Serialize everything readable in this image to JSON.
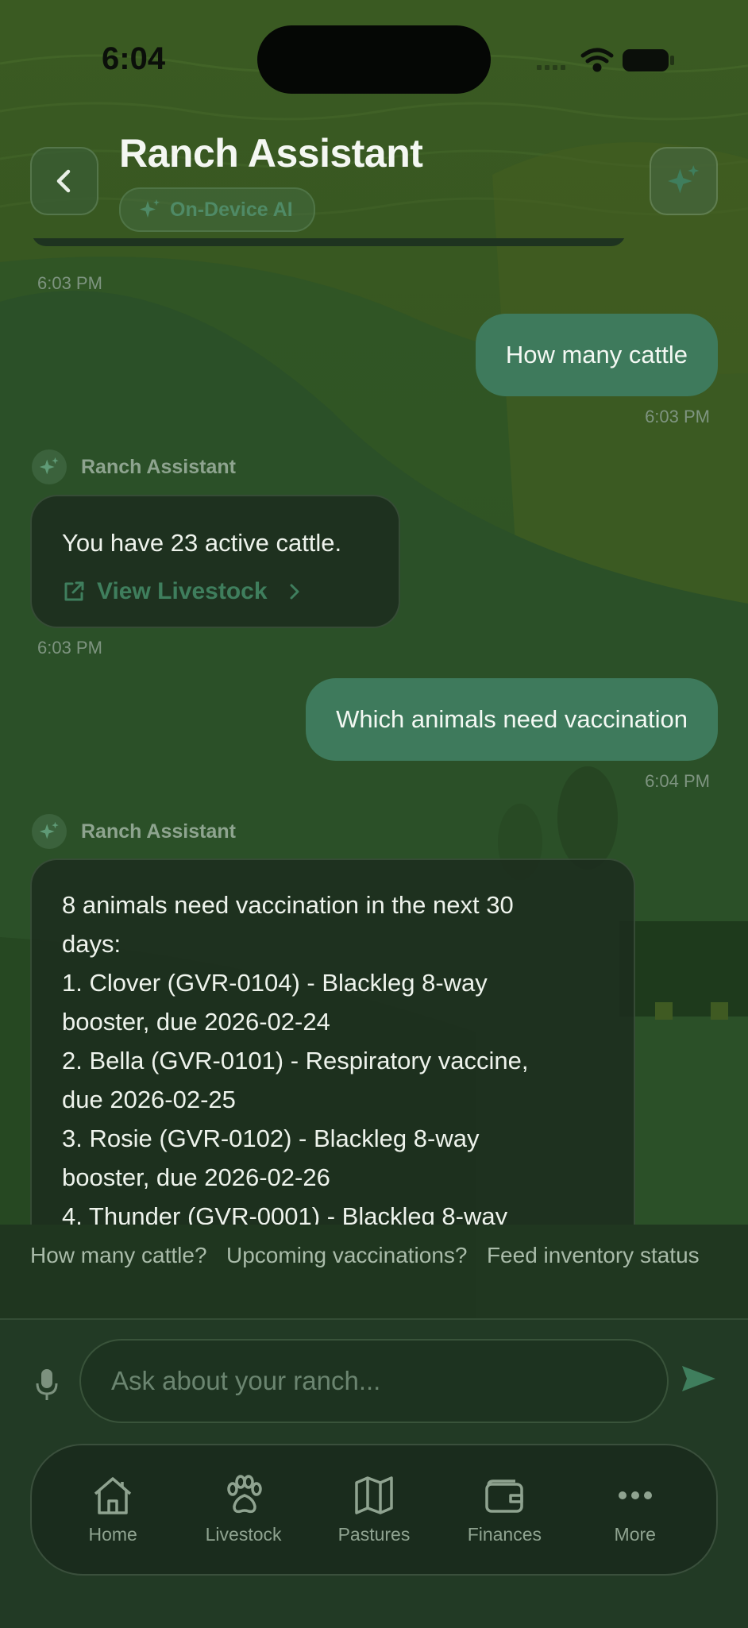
{
  "status_bar": {
    "time": "6:04"
  },
  "header": {
    "title": "Ranch Assistant",
    "badge": "On-Device AI"
  },
  "chat": {
    "messages": [
      {
        "role": "assistant",
        "timestamp": "6:03 PM"
      },
      {
        "role": "user",
        "text": "How many cattle",
        "timestamp": "6:03 PM"
      },
      {
        "role": "assistant",
        "sender": "Ranch Assistant",
        "text": "You have 23 active cattle.",
        "link_label": "View Livestock",
        "timestamp": "6:03 PM"
      },
      {
        "role": "user",
        "text": "Which animals need vaccination",
        "timestamp": "6:04 PM"
      },
      {
        "role": "assistant",
        "sender": "Ranch Assistant",
        "lines": [
          "8 animals need vaccination in the next 30",
          "days:",
          "1. Clover (GVR-0104) - Blackleg 8-way",
          "booster, due 2026-02-24",
          "2. Bella (GVR-0101) - Respiratory vaccine,",
          "due 2026-02-25",
          "3. Rosie (GVR-0102) - Blackleg 8-way",
          "booster, due 2026-02-26",
          "4. Thunder (GVR-0001) - Blackleg 8-way"
        ]
      }
    ]
  },
  "suggestions": [
    "How many cattle?",
    "Upcoming vaccinations?",
    "Feed inventory status"
  ],
  "input": {
    "placeholder": "Ask about your ranch..."
  },
  "tabbar": {
    "items": [
      {
        "label": "Home",
        "icon": "house-icon"
      },
      {
        "label": "Livestock",
        "icon": "paw-icon"
      },
      {
        "label": "Pastures",
        "icon": "map-icon"
      },
      {
        "label": "Finances",
        "icon": "wallet-icon"
      },
      {
        "label": "More",
        "icon": "ellipsis-icon"
      }
    ]
  },
  "colors": {
    "accent": "#3e7a5c",
    "background": "#2c4a24",
    "bubble_assistant": "#1c2c1e",
    "link": "#3f7e5d"
  }
}
